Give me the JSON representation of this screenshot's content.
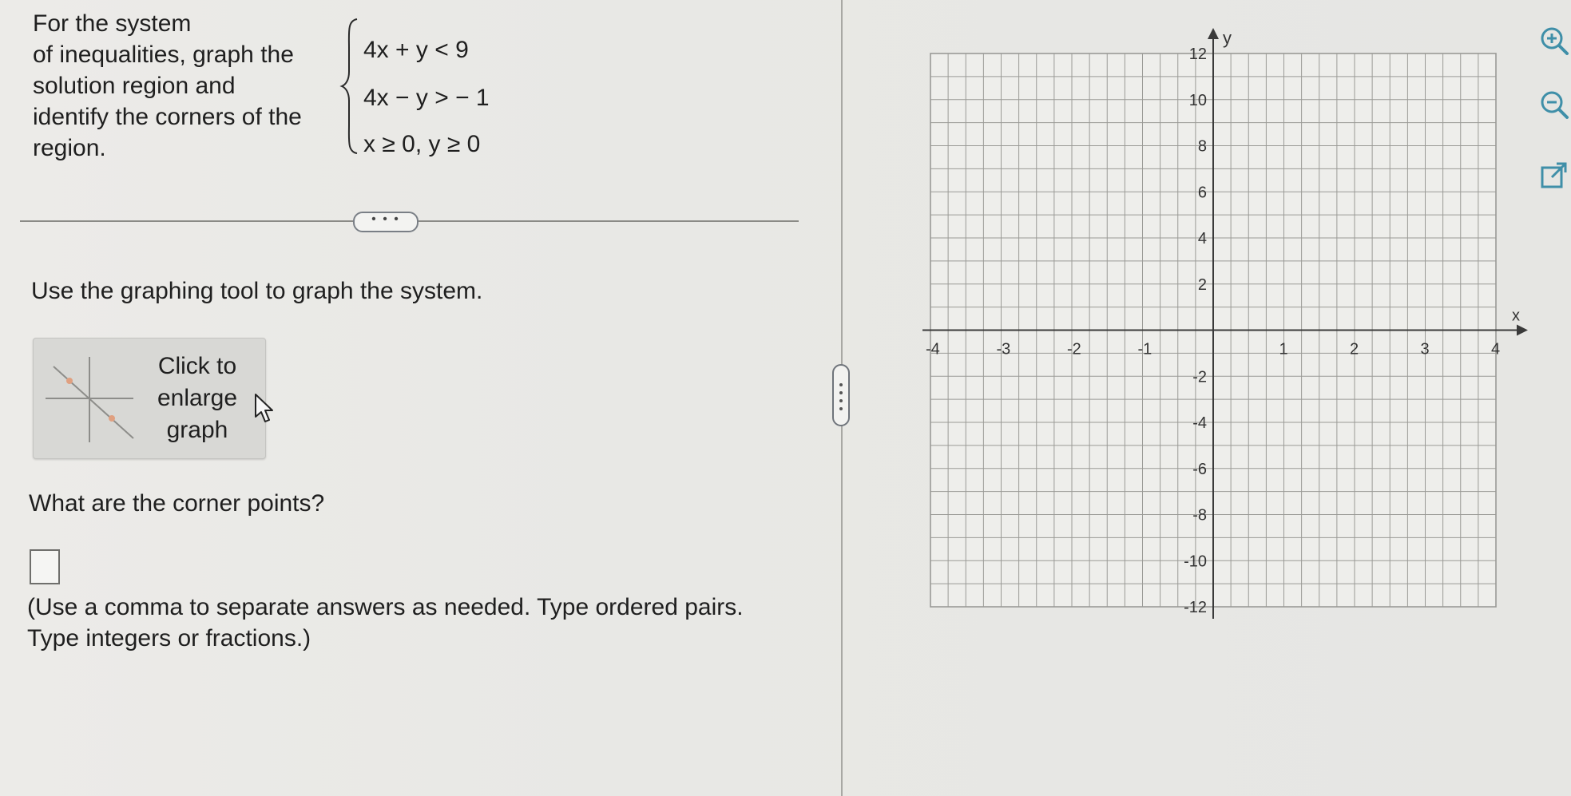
{
  "problem": {
    "prompt_lines": [
      "For the system",
      "of inequalities, graph the",
      "solution region and",
      "identify the corners of the",
      "region."
    ],
    "inequalities": [
      "4x + y < 9",
      "4x − y > − 1",
      "x ≥ 0, y ≥ 0"
    ]
  },
  "more_button_label": "• • •",
  "instruction": "Use the graphing tool to graph the system.",
  "enlarge_button": {
    "lines": [
      "Click to",
      "enlarge",
      "graph"
    ]
  },
  "question": "What are the corner points?",
  "answer_input": {
    "value": ""
  },
  "hint_lines": [
    "(Use a comma to separate answers as needed. Type ordered pairs.",
    "Type integers or fractions.)"
  ],
  "graph": {
    "x_axis_label": "x",
    "y_axis_label": "y",
    "x_range": [
      -4,
      4
    ],
    "y_range": [
      -12,
      12
    ],
    "x_tick_labels": [
      "-4",
      "-3",
      "-2",
      "-1",
      "1",
      "2",
      "3",
      "4"
    ],
    "y_tick_labels": [
      "12",
      "10",
      "8",
      "6",
      "4",
      "2",
      "-2",
      "-4",
      "-6",
      "-8",
      "-10",
      "-12"
    ],
    "grid": true
  },
  "tools": {
    "zoom_in_icon": "zoom-in-icon",
    "zoom_out_icon": "zoom-out-icon",
    "popout_icon": "external-link-icon"
  },
  "colors": {
    "tool_icon": "#3f8fa8",
    "grid_line": "#9a9a96",
    "axis": "#3a3a3a"
  }
}
